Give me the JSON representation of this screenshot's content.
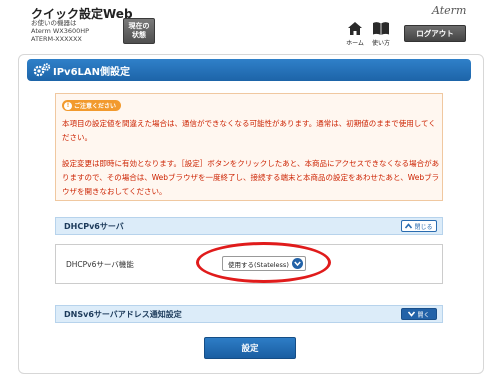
{
  "header": {
    "app_title": "クイック設定Web",
    "device_label": "お使いの機器は",
    "model_name": "Aterm WX3600HP",
    "device_id": "ATERM-XXXXXX",
    "status_button_line1": "現在の",
    "status_button_line2": "状態",
    "brand": "Aterm",
    "nav": {
      "home_label": "ホーム",
      "help_label": "使い方"
    },
    "logout_label": "ログアウト"
  },
  "section": {
    "title": "IPv6LAN側設定",
    "icon": "gear-icon"
  },
  "notice": {
    "badge": "ご注意ください",
    "paragraph1": "本項目の設定値を間違えた場合は、通信ができなくなる可能性があります。通常は、初期値のままで使用してください。",
    "paragraph2": "設定変更は即時に有効となります。［設定］ボタンをクリックしたあと、本商品にアクセスできなくなる場合がありますので、その場合は、Webブラウザを一度終了し、接続する端末と本商品の設定をあわせたあと、Webブラウザを開きなおしてください。",
    "text_color": "#cc2200"
  },
  "dhcpv6": {
    "title": "DHCPv6サーバ",
    "toggle_label": "閉じる",
    "field_label": "DHCPv6サーバ機能",
    "selected_value": "使用する(Stateless)"
  },
  "dnsv6": {
    "title": "DNSv6サーバアドレス通知設定",
    "toggle_label": "開く"
  },
  "submit_label": "設定",
  "colors": {
    "accent": "#1d64a8",
    "highlight": "#e01b1b",
    "section_header": "#dcecf9"
  }
}
